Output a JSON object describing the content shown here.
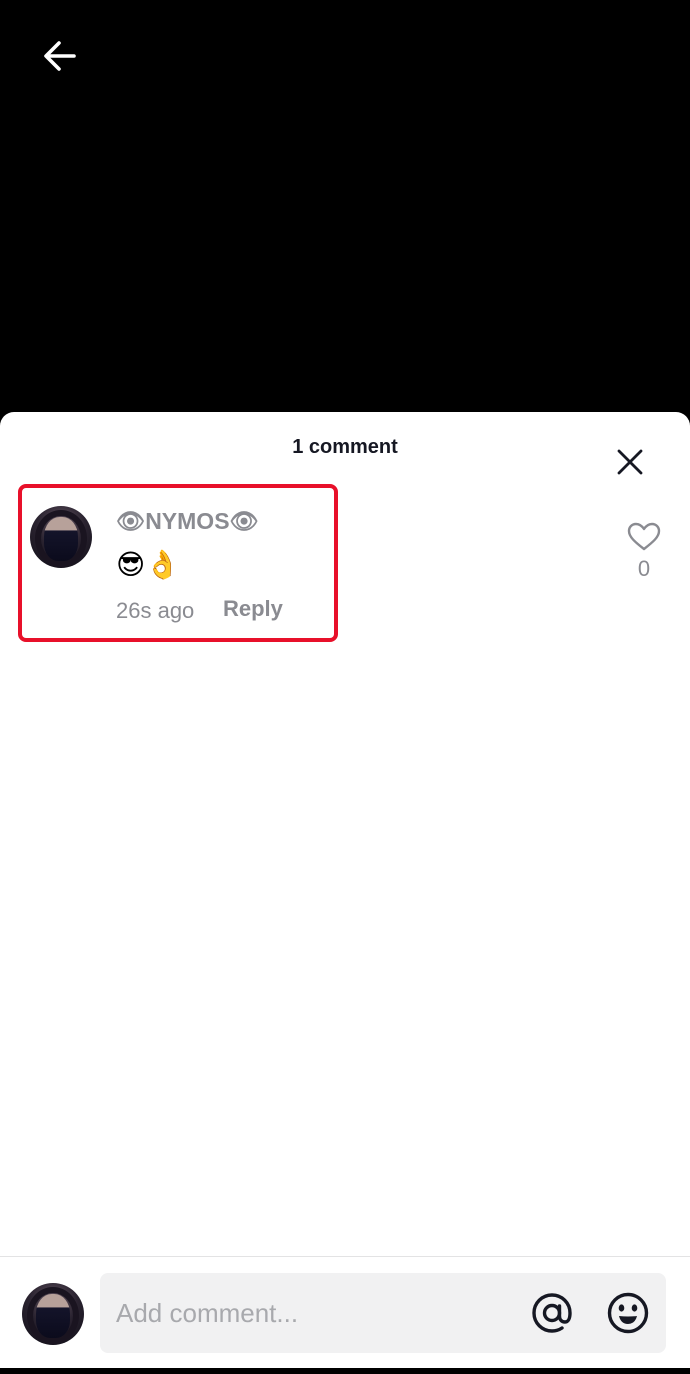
{
  "header": {
    "back_icon": "arrow-left-icon"
  },
  "sheet": {
    "title": "1 comment",
    "close_icon": "close-icon"
  },
  "comment": {
    "username": "👁NYMOS👁",
    "text": "😎👌",
    "time": "26s ago",
    "reply_label": "Reply",
    "like_icon": "heart-outline-icon",
    "like_count": "0",
    "highlight_color": "#e8102a"
  },
  "composer": {
    "placeholder": "Add comment...",
    "mention_icon": "at-sign-icon",
    "emoji_icon": "emoji-icon"
  },
  "colors": {
    "muted_text": "#8a8b91",
    "title_text": "#161823",
    "input_bg": "#f1f1f2"
  }
}
